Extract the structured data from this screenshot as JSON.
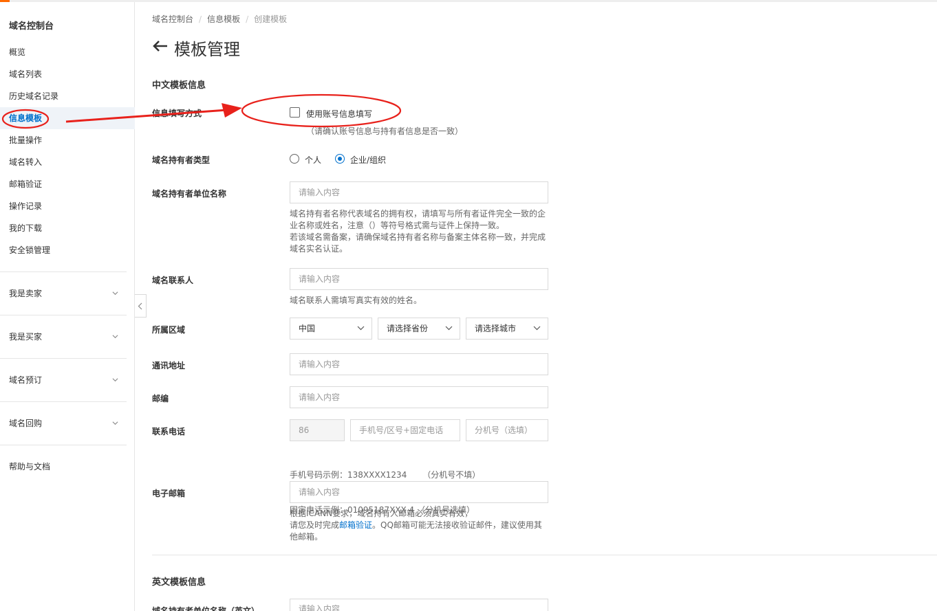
{
  "sidebar": {
    "title": "域名控制台",
    "items": [
      {
        "label": "概览"
      },
      {
        "label": "域名列表"
      },
      {
        "label": "历史域名记录"
      },
      {
        "label": "信息模板"
      },
      {
        "label": "批量操作"
      },
      {
        "label": "域名转入"
      },
      {
        "label": "邮箱验证"
      },
      {
        "label": "操作记录"
      },
      {
        "label": "我的下载"
      },
      {
        "label": "安全锁管理"
      }
    ],
    "groups": [
      {
        "label": "我是卖家"
      },
      {
        "label": "我是买家"
      },
      {
        "label": "域名预订"
      },
      {
        "label": "域名回购"
      }
    ],
    "help": "帮助与文档"
  },
  "breadcrumb": [
    "域名控制台",
    "信息模板",
    "创建模板"
  ],
  "page_title": "模板管理",
  "cn_section": {
    "title": "中文模板信息",
    "fill_mode": {
      "label": "信息填写方式",
      "checkbox_label": "使用账号信息填写",
      "note": "（请确认账号信息与持有者信息是否一致）"
    },
    "owner_type": {
      "label": "域名持有者类型",
      "options": [
        "个人",
        "企业/组织"
      ],
      "selected": "企业/组织"
    },
    "owner_name": {
      "label": "域名持有者单位名称",
      "placeholder": "请输入内容",
      "help1": "域名持有者名称代表域名的拥有权，请填写与所有者证件完全一致的企",
      "help2": "业名称或姓名，注意（）等符号格式需与证件上保持一致。",
      "help3": "若该域名需备案，请确保域名持有者名称与备案主体名称一致，并完成",
      "help4": "域名实名认证。"
    },
    "contact": {
      "label": "域名联系人",
      "placeholder": "请输入内容",
      "help": "域名联系人需填写真实有效的姓名。"
    },
    "region": {
      "label": "所属区域",
      "country": "中国",
      "province": "请选择省份",
      "city": "请选择城市"
    },
    "address": {
      "label": "通讯地址",
      "placeholder": "请输入内容"
    },
    "postcode": {
      "label": "邮编",
      "placeholder": "请输入内容"
    },
    "phone": {
      "label": "联系电话",
      "country_code": "86",
      "number_placeholder": "手机号/区号+固定电话",
      "ext_placeholder": "分机号（选填）",
      "help1": "手机号码示例：138XXXX1234      （分机号不填）",
      "help2": "固定电话示例：01095187XXX 4 （分机号选填）"
    },
    "email": {
      "label": "电子邮箱",
      "placeholder": "请输入内容",
      "help1": "根据ICANN要求，域名持有人邮箱必须真实有效，",
      "help2_pre": "请您及时完成",
      "help2_link": "邮箱验证",
      "help2_post": "。QQ邮箱可能无法接收验证邮件，建议使用其",
      "help3": "他邮箱。"
    }
  },
  "en_section": {
    "title": "英文模板信息",
    "owner_name": {
      "label": "域名持有者单位名称（英文）",
      "placeholder": "请输入内容"
    }
  },
  "colors": {
    "accent": "#ff6a00",
    "link": "#0070cc",
    "annotation": "#e8211b"
  }
}
